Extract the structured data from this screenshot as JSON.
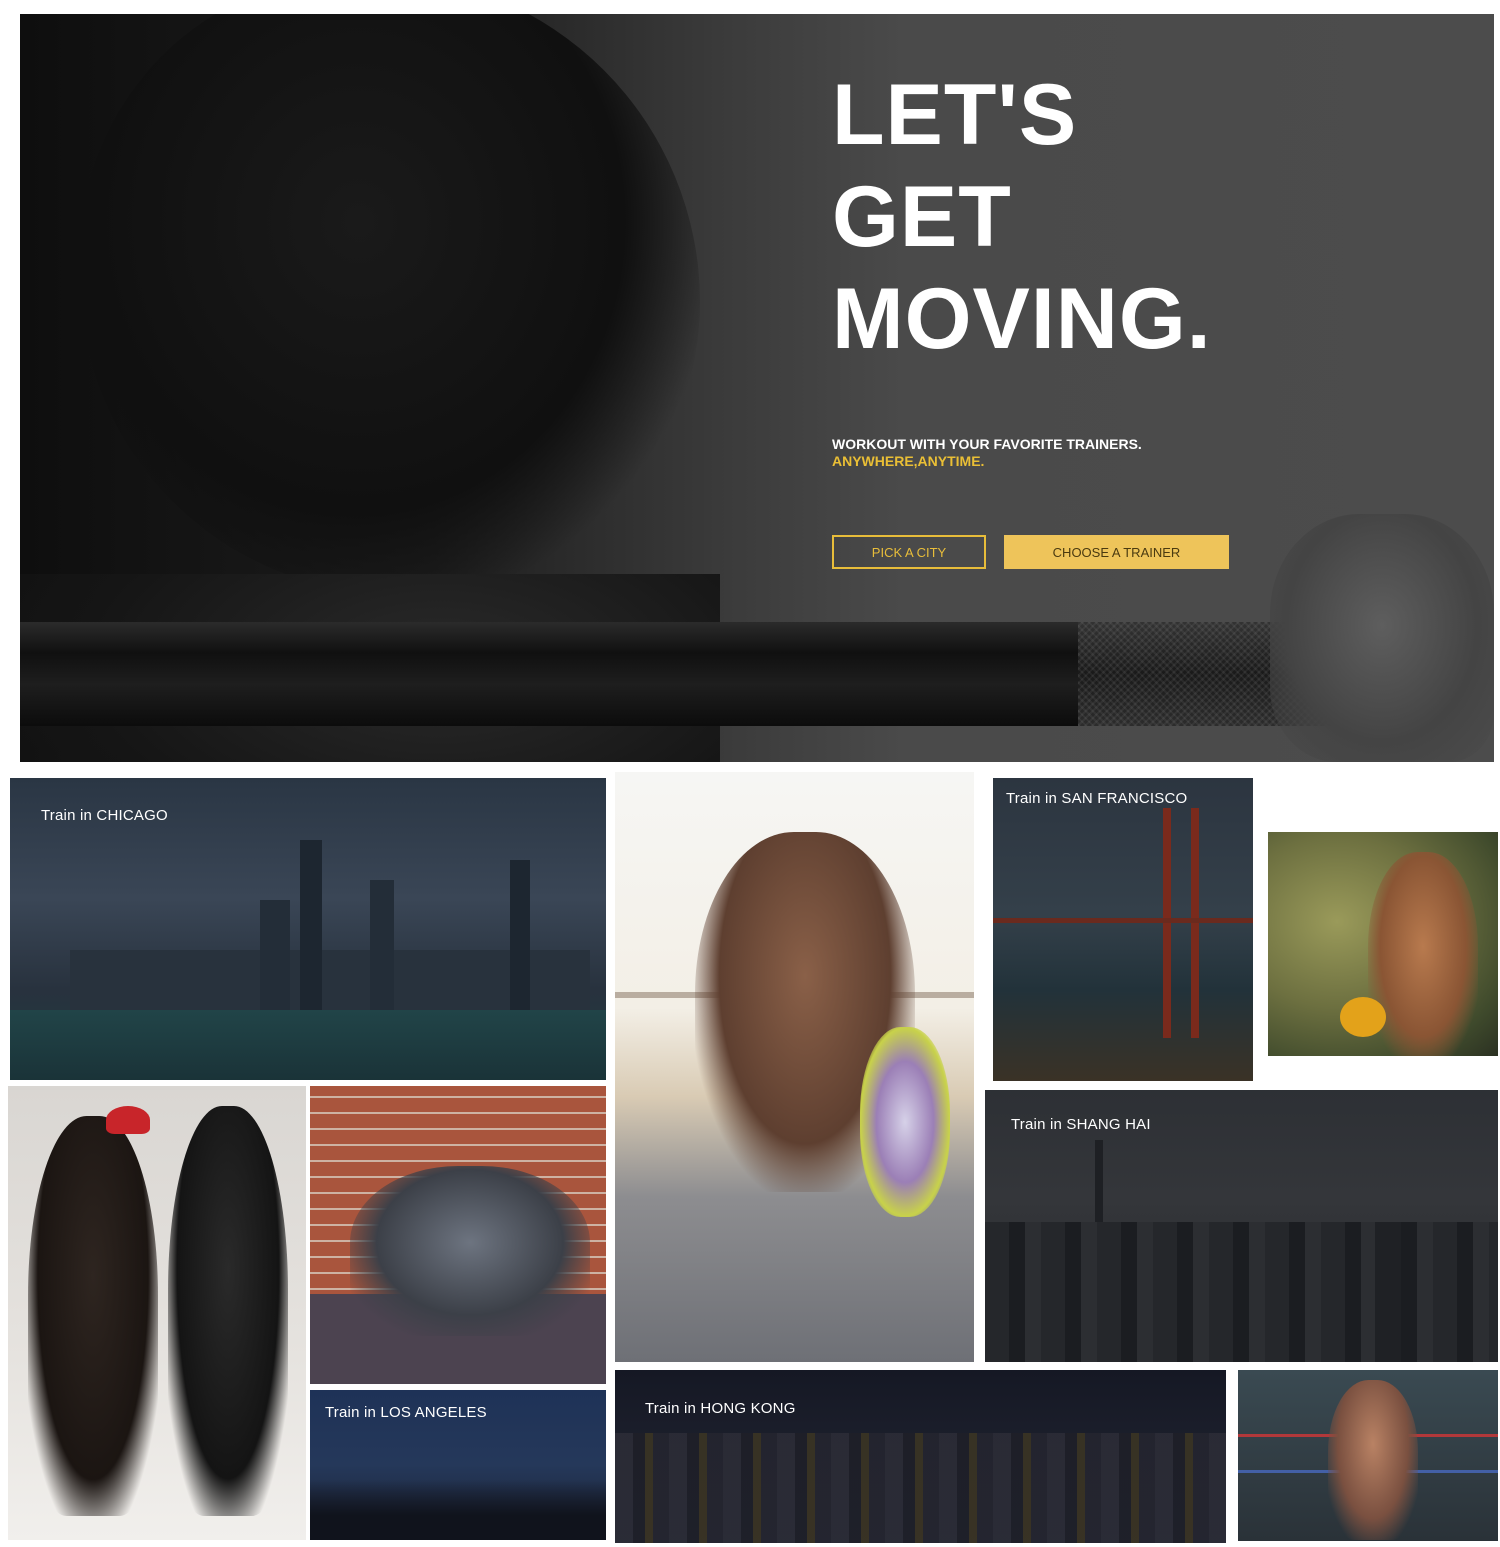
{
  "hero": {
    "headline": [
      "LET'S",
      "GET",
      "MOVING."
    ],
    "subline": "WORKOUT WITH YOUR FAVORITE TRAINERS.",
    "subline_accent": "ANYWHERE,ANYTIME.",
    "pick_city_label": "PICK A CITY",
    "choose_trainer_label": "CHOOSE A TRAINER"
  },
  "colors": {
    "accent": "#eabf35",
    "button_fill": "#eec45a",
    "hero_bg": "#4a4a4a"
  },
  "tiles": {
    "chicago": "Train in CHICAGO",
    "san_francisco": "Train in SAN FRANCISCO",
    "shanghai": "Train in SHANG HAI",
    "los_angeles": "Train in LOS ANGELES",
    "hong_kong": "Train in HONG KONG"
  }
}
